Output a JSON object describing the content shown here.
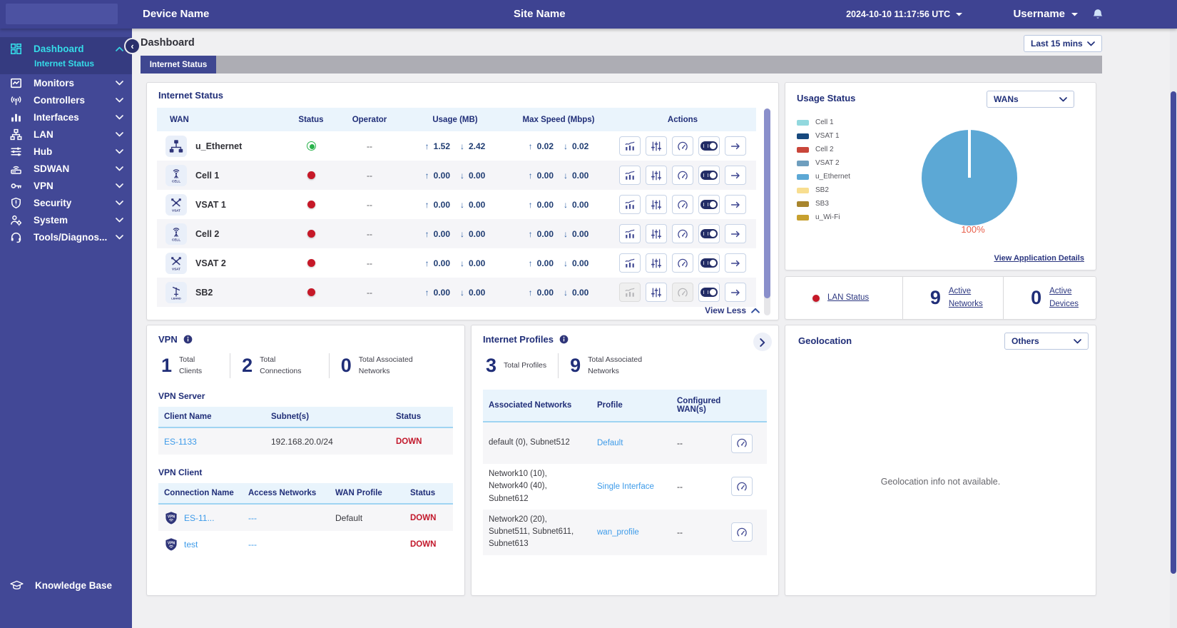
{
  "topbar": {
    "device_name": "Device Name",
    "site_name": "Site Name",
    "datetime": "2024-10-10 11:17:56 UTC",
    "username": "Username"
  },
  "sidebar": {
    "items": [
      {
        "label": "Dashboard",
        "icon": "dashboard",
        "active": true,
        "expanded": true
      },
      {
        "label": "Internet Status",
        "subitem": true,
        "active": true
      },
      {
        "label": "Monitors",
        "icon": "monitors"
      },
      {
        "label": "Controllers",
        "icon": "controllers"
      },
      {
        "label": "Interfaces",
        "icon": "interfaces"
      },
      {
        "label": "LAN",
        "icon": "lan"
      },
      {
        "label": "Hub",
        "icon": "hub"
      },
      {
        "label": "SDWAN",
        "icon": "sdwan"
      },
      {
        "label": "VPN",
        "icon": "vpn"
      },
      {
        "label": "Security",
        "icon": "security"
      },
      {
        "label": "System",
        "icon": "system"
      },
      {
        "label": "Tools/Diagnos...",
        "icon": "tools"
      }
    ],
    "footer": {
      "label": "Knowledge Base"
    }
  },
  "page": {
    "title": "Dashboard",
    "time_range": "Last 15 mins",
    "active_tab": "Internet Status"
  },
  "internet_status": {
    "title": "Internet Status",
    "columns": [
      "WAN",
      "Status",
      "Operator",
      "Usage (MB)",
      "Max Speed (Mbps)",
      "Actions"
    ],
    "rows": [
      {
        "name": "u_Ethernet",
        "icon": "ethernet",
        "status": "up",
        "operator": "--",
        "usage_up": "1.52",
        "usage_down": "2.42",
        "speed_up": "0.02",
        "speed_down": "0.02",
        "disabled": false
      },
      {
        "name": "Cell 1",
        "icon": "cell",
        "status": "down",
        "operator": "--",
        "usage_up": "0.00",
        "usage_down": "0.00",
        "speed_up": "0.00",
        "speed_down": "0.00",
        "disabled": false
      },
      {
        "name": "VSAT 1",
        "icon": "vsat",
        "status": "down",
        "operator": "--",
        "usage_up": "0.00",
        "usage_down": "0.00",
        "speed_up": "0.00",
        "speed_down": "0.00",
        "disabled": false
      },
      {
        "name": "Cell 2",
        "icon": "cell",
        "status": "down",
        "operator": "--",
        "usage_up": "0.00",
        "usage_down": "0.00",
        "speed_up": "0.00",
        "speed_down": "0.00",
        "disabled": false
      },
      {
        "name": "VSAT 2",
        "icon": "vsat",
        "status": "down",
        "operator": "--",
        "usage_up": "0.00",
        "usage_down": "0.00",
        "speed_up": "0.00",
        "speed_down": "0.00",
        "disabled": false
      },
      {
        "name": "SB2",
        "icon": "lband",
        "status": "down",
        "operator": "--",
        "usage_up": "0.00",
        "usage_down": "0.00",
        "speed_up": "0.00",
        "speed_down": "0.00",
        "disabled": true
      }
    ],
    "view_less_label": "View Less"
  },
  "usage_status": {
    "title": "Usage Status",
    "filter_value": "WANs",
    "legend": [
      {
        "label": "Cell 1",
        "color": "#92D8DE"
      },
      {
        "label": "VSAT 1",
        "color": "#17497E"
      },
      {
        "label": "Cell 2",
        "color": "#C9463A"
      },
      {
        "label": "VSAT 2",
        "color": "#6E9EBE"
      },
      {
        "label": "u_Ethernet",
        "color": "#5CA8D5"
      },
      {
        "label": "SB2",
        "color": "#F8DE90"
      },
      {
        "label": "SB3",
        "color": "#A8852D"
      },
      {
        "label": "u_Wi-Fi",
        "color": "#C7A02F"
      }
    ],
    "chart_data": {
      "type": "pie",
      "slices": [
        {
          "label": "u_Ethernet",
          "value": 100,
          "color": "#5CA8D5"
        }
      ],
      "data_label": "100%",
      "data_label_color": "#E8604C"
    },
    "details_link": "View Application Details"
  },
  "lan_summary": {
    "items": [
      {
        "label": "LAN Status",
        "indicator": "down"
      },
      {
        "value": "9",
        "label": "Active Networks"
      },
      {
        "value": "0",
        "label": "Active Devices"
      }
    ]
  },
  "vpn": {
    "title": "VPN",
    "stats": [
      {
        "value": "1",
        "label": "Total Clients"
      },
      {
        "value": "2",
        "label": "Total Connections"
      },
      {
        "value": "0",
        "label": "Total Associated Networks"
      }
    ],
    "server": {
      "title": "VPN Server",
      "columns": [
        "Client Name",
        "Subnet(s)",
        "Status"
      ],
      "rows": [
        {
          "client": "ES-1133",
          "subnets": "192.168.20.0/24",
          "status": "DOWN"
        }
      ]
    },
    "client": {
      "title": "VPN Client",
      "columns": [
        "Connection Name",
        "Access Networks",
        "WAN Profile",
        "Status"
      ],
      "rows": [
        {
          "connection": "ES-11...",
          "access": "---",
          "wan_profile": "Default",
          "status": "DOWN"
        },
        {
          "connection": "test",
          "access": "---",
          "wan_profile": "",
          "status": "DOWN"
        }
      ]
    }
  },
  "internet_profiles": {
    "title": "Internet Profiles",
    "stats": [
      {
        "value": "3",
        "label": "Total Profiles"
      },
      {
        "value": "9",
        "label": "Total Associated Networks"
      }
    ],
    "columns": [
      "Associated Networks",
      "Profile",
      "Configured WAN(s)"
    ],
    "rows": [
      {
        "networks": "default (0), Subnet512",
        "profile": "Default",
        "configured": "--"
      },
      {
        "networks": "Network10 (10), Network40 (40), Subnet612",
        "profile": "Single Interface",
        "configured": "--"
      },
      {
        "networks": "Network20 (20), Subnet511, Subnet611, Subnet613",
        "profile": "wan_profile",
        "configured": "--"
      }
    ]
  },
  "geolocation": {
    "title": "Geolocation",
    "filter_value": "Others",
    "empty_message": "Geolocation info not available."
  },
  "colors": {
    "topbar": "#3E4392",
    "sidebar": "#424896",
    "sidebar_active_bg": "#353B80",
    "sidebar_active_text": "#35DCE8",
    "tab_active": "#3F4791",
    "navy_text": "#202E78",
    "link_blue": "#3D9BE9",
    "down_red": "#C2182B",
    "up_green": "#27B24A"
  }
}
